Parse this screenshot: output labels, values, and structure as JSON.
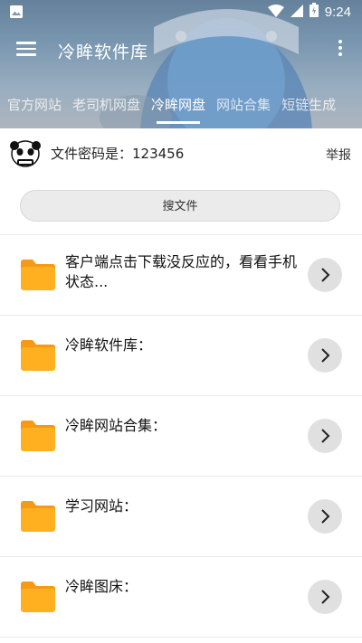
{
  "status": {
    "time": "9:24"
  },
  "toolbar": {
    "title": "冷眸软件库"
  },
  "tabs": [
    {
      "label": "官方网站"
    },
    {
      "label": "老司机网盘"
    },
    {
      "label": "冷眸网盘"
    },
    {
      "label": "网站合集"
    },
    {
      "label": "短链生成"
    }
  ],
  "info": {
    "password_text": "文件密码是：123456",
    "report_label": "举报"
  },
  "search": {
    "button_label": "搜文件"
  },
  "files": [
    {
      "title": "客户端点击下载没反应的，看看手机状态..."
    },
    {
      "title": "冷眸软件库："
    },
    {
      "title": "冷眸网站合集："
    },
    {
      "title": "学习网站："
    },
    {
      "title": "冷眸图床："
    }
  ],
  "colors": {
    "folder": "#ffb020",
    "folder_tab": "#f59a12",
    "arrow_bg": "#e0e0e0"
  }
}
